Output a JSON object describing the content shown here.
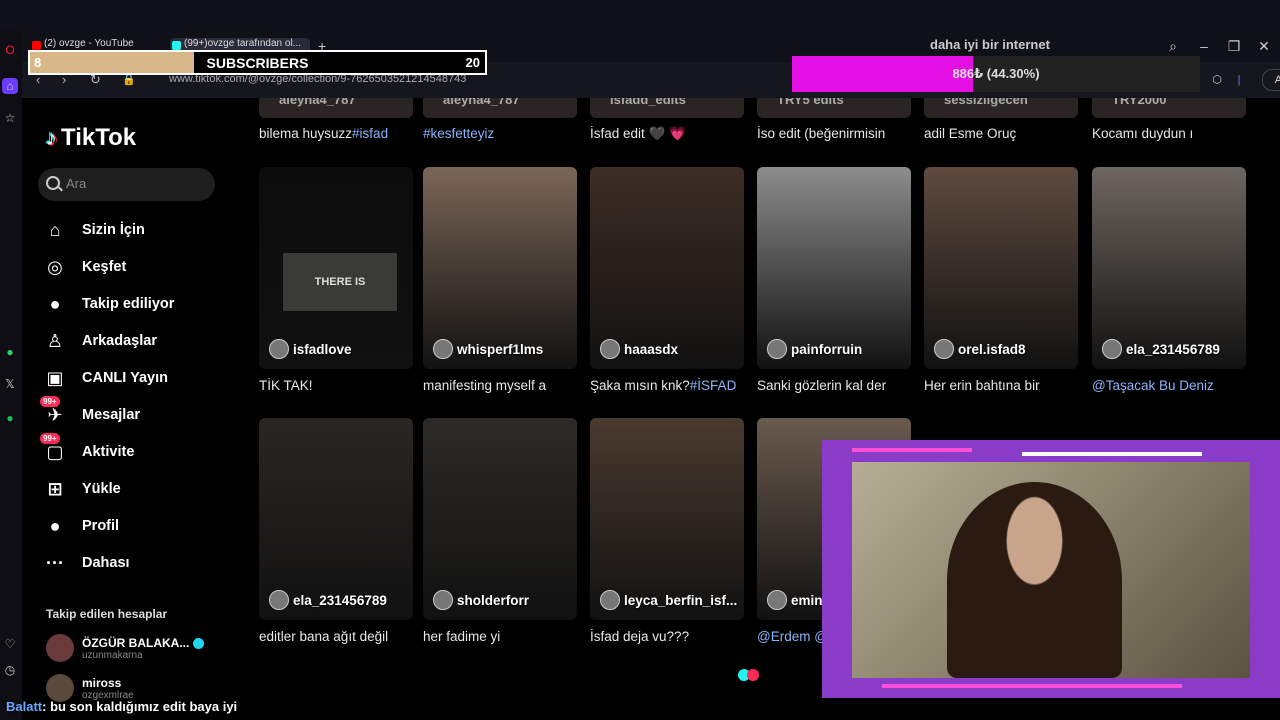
{
  "browser": {
    "tabs": [
      {
        "label": "(2) ovzge - YouTube",
        "color": "#ff0000"
      },
      {
        "label": "(99+)ovzge tarafından ol...",
        "color": "#25f4ee"
      }
    ],
    "window_title": "daha iyi bir internet",
    "url": "www.tiktok.com/@ovzge/collection/9-7626503521214548743",
    "ai_label": "AI"
  },
  "overlay": {
    "subscribers": {
      "label": "SUBSCRIBERS",
      "min": "8",
      "max": "20",
      "fraction": 0.36
    },
    "goal": {
      "label": "886₺ (44.30%)",
      "percent": 44.3
    }
  },
  "sidebar": {
    "logo_text": "TikTok",
    "search_placeholder": "Ara",
    "nav": [
      {
        "label": "Sizin İçin",
        "icon": "home-icon",
        "glyph": "⌂"
      },
      {
        "label": "Keşfet",
        "icon": "compass-icon",
        "glyph": "◎"
      },
      {
        "label": "Takip ediliyor",
        "icon": "following-avatar-icon",
        "glyph": "●"
      },
      {
        "label": "Arkadaşlar",
        "icon": "friends-icon",
        "glyph": "♙"
      },
      {
        "label": "CANLI Yayın",
        "icon": "live-tv-icon",
        "glyph": "▣"
      },
      {
        "label": "Mesajlar",
        "icon": "message-icon",
        "glyph": "✈",
        "badge": "99+"
      },
      {
        "label": "Aktivite",
        "icon": "activity-icon",
        "glyph": "▢",
        "badge": "99+"
      },
      {
        "label": "Yükle",
        "icon": "upload-icon",
        "glyph": "⊞"
      },
      {
        "label": "Profil",
        "icon": "profile-avatar-icon",
        "glyph": "●"
      },
      {
        "label": "Dahası",
        "icon": "more-icon",
        "glyph": "···"
      }
    ],
    "following_heading": "Takip edilen hesaplar",
    "following": [
      {
        "name": "ÖZGÜR BALAKA...",
        "user": "uzunmakarna",
        "verified": true
      },
      {
        "name": "miross",
        "user": "ozgexmlrae",
        "verified": false
      }
    ]
  },
  "grid": {
    "top_row": [
      {
        "user": "aleyna4_787",
        "caption": "bilema huysuzz",
        "tag": "#isfad"
      },
      {
        "user": "aleyna4_787",
        "caption": "",
        "tag": "#kesfetteyiz"
      },
      {
        "user": "isfadd_edits",
        "caption": "İsfad edit 🖤 💗",
        "tag": ""
      },
      {
        "user": "TRY5 edits",
        "caption": "İso edit (beğenirmisin",
        "tag": ""
      },
      {
        "user": "sessizligecen",
        "caption": "adil Esme Oruç",
        "tag": ""
      },
      {
        "user": "TRY2000",
        "caption": "Kocamı duydun ı",
        "tag": ""
      }
    ],
    "row1": [
      {
        "user": "isfadlove",
        "caption": "TİK TAK!",
        "tag": "",
        "bg": "#0b0b0b",
        "thumb_text": "THERE IS"
      },
      {
        "user": "whisperf1lms",
        "caption": "manifesting myself a",
        "tag": "",
        "bg": "#7a6657"
      },
      {
        "user": "haaasdx",
        "caption": "Şaka mısın knk?",
        "tag": "#İSFAD",
        "bg": "#3d2d25"
      },
      {
        "user": "painforruin",
        "caption": "Sanki gözlerin kal der",
        "tag": "",
        "bg": "#8c8c8c"
      },
      {
        "user": "orel.isfad8",
        "caption": "Her erin bahtına bir",
        "tag": "",
        "bg": "#5d4a3e"
      },
      {
        "user": "ela_231456789",
        "caption": "@Taşacak Bu Deniz",
        "tag": "",
        "bg": "#6e6660",
        "caption_link": true
      }
    ],
    "row2": [
      {
        "user": "ela_231456789",
        "caption": "editler bana ağıt değil",
        "tag": "",
        "bg": "#2a2624"
      },
      {
        "user": "sholderforr",
        "caption": "her fadime yi",
        "tag": "",
        "bg": "#2d2a27"
      },
      {
        "user": "leyca_berfin_isf...",
        "caption": "İsfad deja vu???",
        "tag": "",
        "bg": "#4a3a2f"
      },
      {
        "user": "emin",
        "caption": "@Erdem @",
        "tag": "",
        "bg": "#6a5a4e",
        "caption_link": true
      }
    ]
  },
  "chat": {
    "user": "Balatt",
    "message": ": bu son kaldığımız edit baya iyi"
  },
  "colors": {
    "accent": "#fe2c55",
    "cyan": "#25f4ee",
    "frame": "#8a3cc8",
    "goal": "#e40fe4",
    "subs": "#d8b888"
  }
}
